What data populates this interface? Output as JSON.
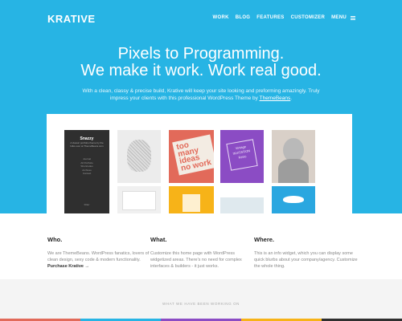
{
  "brand": {
    "logo": "KRATIVE"
  },
  "nav": {
    "items": [
      "WORK",
      "BLOG",
      "FEATURES",
      "CUSTOMIZER"
    ],
    "menu_label": "MENU"
  },
  "hero": {
    "headline_1": "Pixels to Programming.",
    "headline_2": "We make it work. Work real good.",
    "intro_line_1": "With a clean, classy & precise build, Krative will keep your site looking and preforming amazingly. Truly",
    "intro_line_2_pre": "impress your clients with this professional WordPress Theme by",
    "intro_link": "ThemeBeans",
    "intro_line_2_post": ".",
    "bg_color": "#27b4e4"
  },
  "portfolio": {
    "snazzy_title": "Snazzy",
    "snazzy_subtitle": "A classic portfolio theme by the folks over at ThemeBeans.com",
    "snazzy_links": [
      "Journal",
      "All Portfolio",
      "Shortcodes",
      "Archives",
      "Contact"
    ],
    "snazzy_footer": "Filter",
    "tile_ideas": "too many ideas no work",
    "tile_vintage": "Vintage INVITATION Retro"
  },
  "columns": [
    {
      "title": "Who.",
      "text": "We are ThemeBeans. WordPress fanatics, lovers of clean design, sexy code & modern functionality.",
      "link": "Purchase Krative →"
    },
    {
      "title": "What.",
      "text": "Customize this home page with WordPress widgetized areas. There's no need for complex interfaces & builders - it just works.",
      "link": ""
    },
    {
      "title": "Where.",
      "text": "This is an info widget, which you can display some quick blurbs about your company/agency. Customize the whole thing.",
      "link": ""
    }
  ],
  "footer": {
    "label": "WHAT WE HAVE BEEN WORKING ON"
  }
}
